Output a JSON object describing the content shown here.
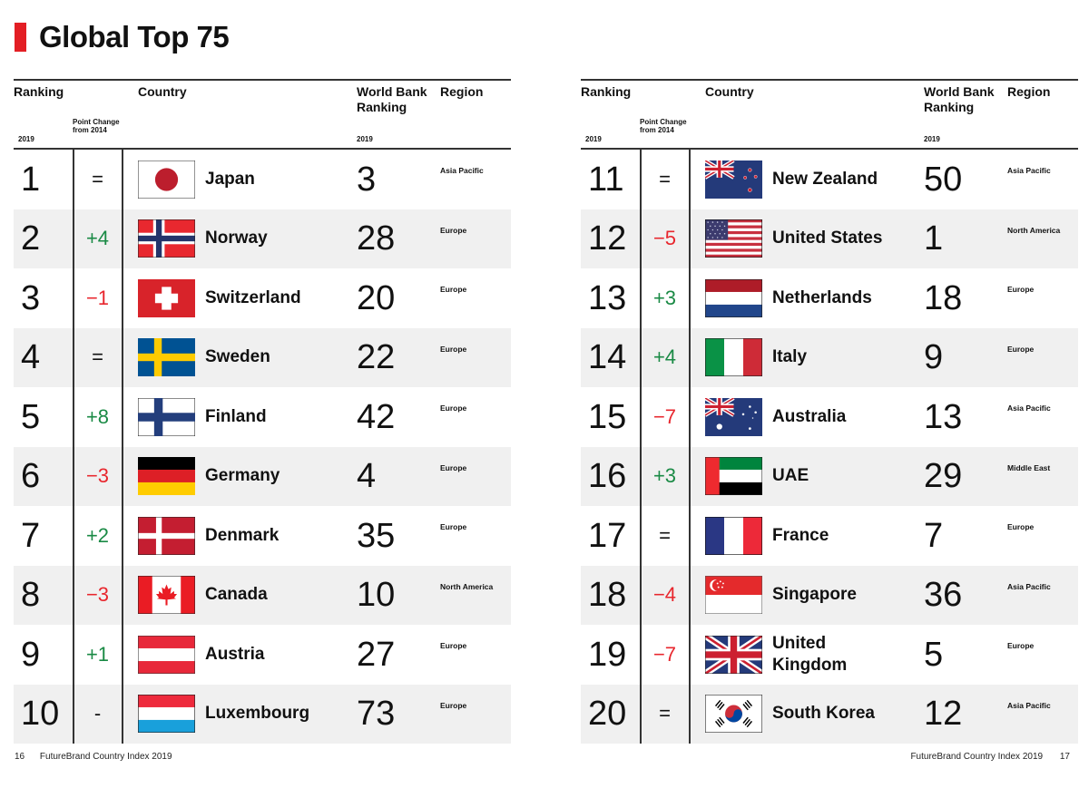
{
  "title": "Global Top 75",
  "accent_color": "#e31e24",
  "colors": {
    "up": "#1a8a45",
    "down": "#e8262d",
    "row_shade": "#f0f0f0"
  },
  "headers": {
    "ranking": "Ranking",
    "ranking_year": "2019",
    "point_change": "Point Change from 2014",
    "country": "Country",
    "world_bank": "World Bank Ranking",
    "world_bank_year": "2019",
    "region": "Region"
  },
  "pages": [
    {
      "page_number": "16",
      "footer": "FutureBrand Country Index 2019",
      "rows": [
        {
          "rank": "1",
          "change": "=",
          "trend": "same",
          "country": "Japan",
          "flag": "japan-flag",
          "wb": "3",
          "region": "Asia Pacific"
        },
        {
          "rank": "2",
          "change": "+4",
          "trend": "up",
          "country": "Norway",
          "flag": "norway-flag",
          "wb": "28",
          "region": "Europe"
        },
        {
          "rank": "3",
          "change": "−1",
          "trend": "down",
          "country": "Switzerland",
          "flag": "switzerland-flag",
          "wb": "20",
          "region": "Europe"
        },
        {
          "rank": "4",
          "change": "=",
          "trend": "same",
          "country": "Sweden",
          "flag": "sweden-flag",
          "wb": "22",
          "region": "Europe"
        },
        {
          "rank": "5",
          "change": "+8",
          "trend": "up",
          "country": "Finland",
          "flag": "finland-flag",
          "wb": "42",
          "region": "Europe"
        },
        {
          "rank": "6",
          "change": "−3",
          "trend": "down",
          "country": "Germany",
          "flag": "germany-flag",
          "wb": "4",
          "region": "Europe"
        },
        {
          "rank": "7",
          "change": "+2",
          "trend": "up",
          "country": "Denmark",
          "flag": "denmark-flag",
          "wb": "35",
          "region": "Europe"
        },
        {
          "rank": "8",
          "change": "−3",
          "trend": "down",
          "country": "Canada",
          "flag": "canada-flag",
          "wb": "10",
          "region": "North America"
        },
        {
          "rank": "9",
          "change": "+1",
          "trend": "up",
          "country": "Austria",
          "flag": "austria-flag",
          "wb": "27",
          "region": "Europe"
        },
        {
          "rank": "10",
          "change": "-",
          "trend": "same",
          "country": "Luxembourg",
          "flag": "luxembourg-flag",
          "wb": "73",
          "region": "Europe"
        }
      ]
    },
    {
      "page_number": "17",
      "footer": "FutureBrand Country Index 2019",
      "rows": [
        {
          "rank": "11",
          "change": "=",
          "trend": "same",
          "country": "New Zealand",
          "flag": "new-zealand-flag",
          "wb": "50",
          "region": "Asia Pacific"
        },
        {
          "rank": "12",
          "change": "−5",
          "trend": "down",
          "country": "United States",
          "flag": "united-states-flag",
          "wb": "1",
          "region": "North America"
        },
        {
          "rank": "13",
          "change": "+3",
          "trend": "up",
          "country": "Netherlands",
          "flag": "netherlands-flag",
          "wb": "18",
          "region": "Europe"
        },
        {
          "rank": "14",
          "change": "+4",
          "trend": "up",
          "country": "Italy",
          "flag": "italy-flag",
          "wb": "9",
          "region": "Europe"
        },
        {
          "rank": "15",
          "change": "−7",
          "trend": "down",
          "country": "Australia",
          "flag": "australia-flag",
          "wb": "13",
          "region": "Asia Pacific"
        },
        {
          "rank": "16",
          "change": "+3",
          "trend": "up",
          "country": "UAE",
          "flag": "uae-flag",
          "wb": "29",
          "region": "Middle East"
        },
        {
          "rank": "17",
          "change": "=",
          "trend": "same",
          "country": "France",
          "flag": "france-flag",
          "wb": "7",
          "region": "Europe"
        },
        {
          "rank": "18",
          "change": "−4",
          "trend": "down",
          "country": "Singapore",
          "flag": "singapore-flag",
          "wb": "36",
          "region": "Asia Pacific"
        },
        {
          "rank": "19",
          "change": "−7",
          "trend": "down",
          "country": "United Kingdom",
          "flag": "united-kingdom-flag",
          "wb": "5",
          "region": "Europe"
        },
        {
          "rank": "20",
          "change": "=",
          "trend": "same",
          "country": "South Korea",
          "flag": "south-korea-flag",
          "wb": "12",
          "region": "Asia Pacific"
        }
      ]
    }
  ]
}
